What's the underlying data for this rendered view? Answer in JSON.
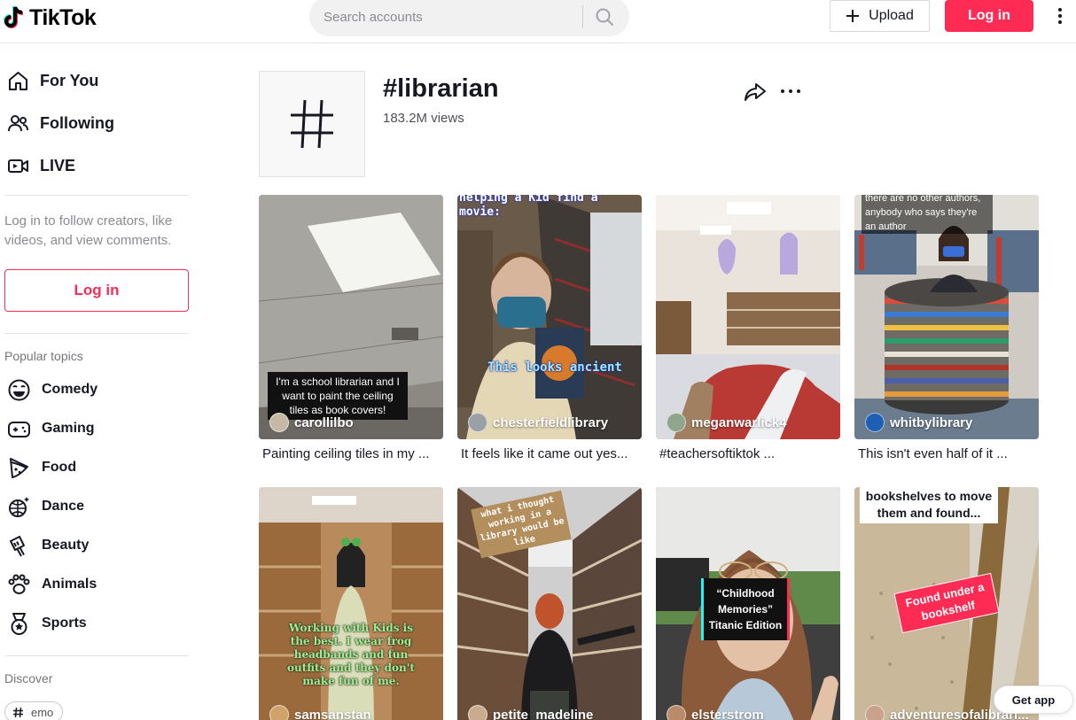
{
  "header": {
    "logo_text": "TikTok",
    "search_placeholder": "Search accounts",
    "upload_label": "Upload",
    "login_label": "Log in"
  },
  "sidebar": {
    "nav": [
      {
        "label": "For You",
        "icon": "home-icon"
      },
      {
        "label": "Following",
        "icon": "following-icon"
      },
      {
        "label": "LIVE",
        "icon": "live-icon"
      }
    ],
    "login_prompt": "Log in to follow creators, like videos, and view comments.",
    "login_button": "Log in",
    "popular_title": "Popular topics",
    "topics": [
      {
        "label": "Comedy",
        "icon": "comedy-icon"
      },
      {
        "label": "Gaming",
        "icon": "gaming-icon"
      },
      {
        "label": "Food",
        "icon": "food-icon"
      },
      {
        "label": "Dance",
        "icon": "dance-icon"
      },
      {
        "label": "Beauty",
        "icon": "beauty-icon"
      },
      {
        "label": "Animals",
        "icon": "animals-icon"
      },
      {
        "label": "Sports",
        "icon": "sports-icon"
      }
    ],
    "discover_title": "Discover",
    "discover_chip": "emo"
  },
  "tag": {
    "title": "#librarian",
    "views": "183.2M views"
  },
  "videos": [
    {
      "author": "carollilbo",
      "caption": "Painting ceiling tiles in my ...",
      "overlay": "I'm a school librarian and I want to paint the ceiling tiles as book covers!"
    },
    {
      "author": "chesterfieldlibrary",
      "caption": "It feels like it came out yes...",
      "overlay_top": "helping a Kid find a movie:",
      "overlay_mid": "This looks ancient"
    },
    {
      "author": "meganwarlick4",
      "caption": "#teachersoftiktok ..."
    },
    {
      "author": "whitbylibrary",
      "caption": "This isn't even half of it ...",
      "overlay": "there are no other authors, anybody who says they're an author"
    },
    {
      "author": "samsanstan",
      "caption": "",
      "overlay": "Working with Kids is the best. I wear frog headbands and fun outfits and they don't make fun of me."
    },
    {
      "author": "petite_madeline",
      "caption": "",
      "overlay": "what i thought working in a library would be like"
    },
    {
      "author": "elsterstrom",
      "caption": "",
      "overlay": "“Childhood Memories” Titanic Edition"
    },
    {
      "author": "adventuresofalibrari...",
      "caption": "",
      "overlay_top": "bookshelves to move them and found...",
      "overlay_mid": "Found under a bookshelf"
    }
  ],
  "get_app": "Get app",
  "colors": {
    "brand": "#fe2c55",
    "text": "#161823",
    "muted": "#8a8b91"
  }
}
